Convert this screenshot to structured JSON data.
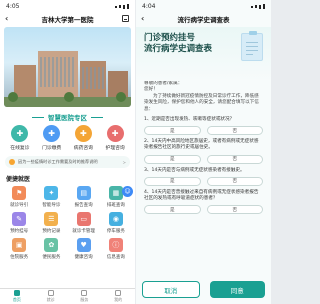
{
  "left": {
    "status_time": "4:05",
    "title": "吉林大学第一医院",
    "feature_title": "智慧医院专区",
    "quick": [
      {
        "label": "在线复诊",
        "color": "#3fb8a9",
        "icon": "chat-icon"
      },
      {
        "label": "门诊缴费",
        "color": "#4f9bf3",
        "icon": "card-icon"
      },
      {
        "label": "病药咨询",
        "color": "#f4a536",
        "icon": "pill-icon"
      },
      {
        "label": "护理咨询",
        "color": "#e86e6e",
        "icon": "nurse-icon"
      }
    ],
    "notice": "因为一些疫情时诊工作需要及时的推荐说明",
    "notice_more": ">",
    "services_title": "便捷就医",
    "services": [
      {
        "label": "就诊导引",
        "color": "#f28b59",
        "icon": "guide-icon"
      },
      {
        "label": "智能导诊",
        "color": "#4db6e8",
        "icon": "robot-icon"
      },
      {
        "label": "报告查询",
        "color": "#5aa7f2",
        "icon": "report-icon"
      },
      {
        "label": "排班查询",
        "color": "#49b5a8",
        "icon": "calendar-icon"
      },
      {
        "label": "预约挂号",
        "color": "#9b86e8",
        "icon": "register-icon"
      },
      {
        "label": "预约记录",
        "color": "#f2b04d",
        "icon": "record-icon"
      },
      {
        "label": "就诊卡管理",
        "color": "#e9766f",
        "icon": "id-card-icon"
      },
      {
        "label": "停车服务",
        "color": "#46b0e0",
        "icon": "car-icon"
      },
      {
        "label": "住院服务",
        "color": "#ee9f63",
        "icon": "bed-icon"
      },
      {
        "label": "便民服务",
        "color": "#69c2a5",
        "icon": "service-icon"
      },
      {
        "label": "健康咨询",
        "color": "#5b9ff0",
        "icon": "heart-icon"
      },
      {
        "label": "信息查询",
        "color": "#f08278",
        "icon": "info-icon"
      }
    ],
    "tabs": [
      {
        "label": "首页",
        "active": true
      },
      {
        "label": "就诊",
        "active": false
      },
      {
        "label": "服务",
        "active": false
      },
      {
        "label": "我的",
        "active": false
      }
    ]
  },
  "right": {
    "status_time": "4:04",
    "title": "流行病学史调查表",
    "header_line1": "门诊预约挂号",
    "header_line2": "流行病学史调查表",
    "greeting": "尊敬的患者/家属：",
    "hello": "您好！",
    "intro": "为了持续做好新冠疫情防控及日常诊疗工作，降低感染发生风险，保护您和他人的安全，请您配合填写以下信息：",
    "questions": [
      {
        "text": "1、近期是否出现发热、咳嗽等症状或状况？",
        "yes": "是",
        "no": "否"
      },
      {
        "text": "2、14天内中高风险地区旅居史，或者有病例或无症状感染者报告社区的旅行史或居住史。",
        "yes": "是",
        "no": "否"
      },
      {
        "text": "3、14天内是否与病例或无症状感染者有接触史。",
        "yes": "是",
        "no": "否"
      },
      {
        "text": "4、14天内是否曾接触过来自有病例或无症状感染者报告社区的发热或有呼吸道症状的患者？",
        "yes": "是",
        "no": "否"
      }
    ],
    "cancel": "取消",
    "confirm": "同意"
  }
}
